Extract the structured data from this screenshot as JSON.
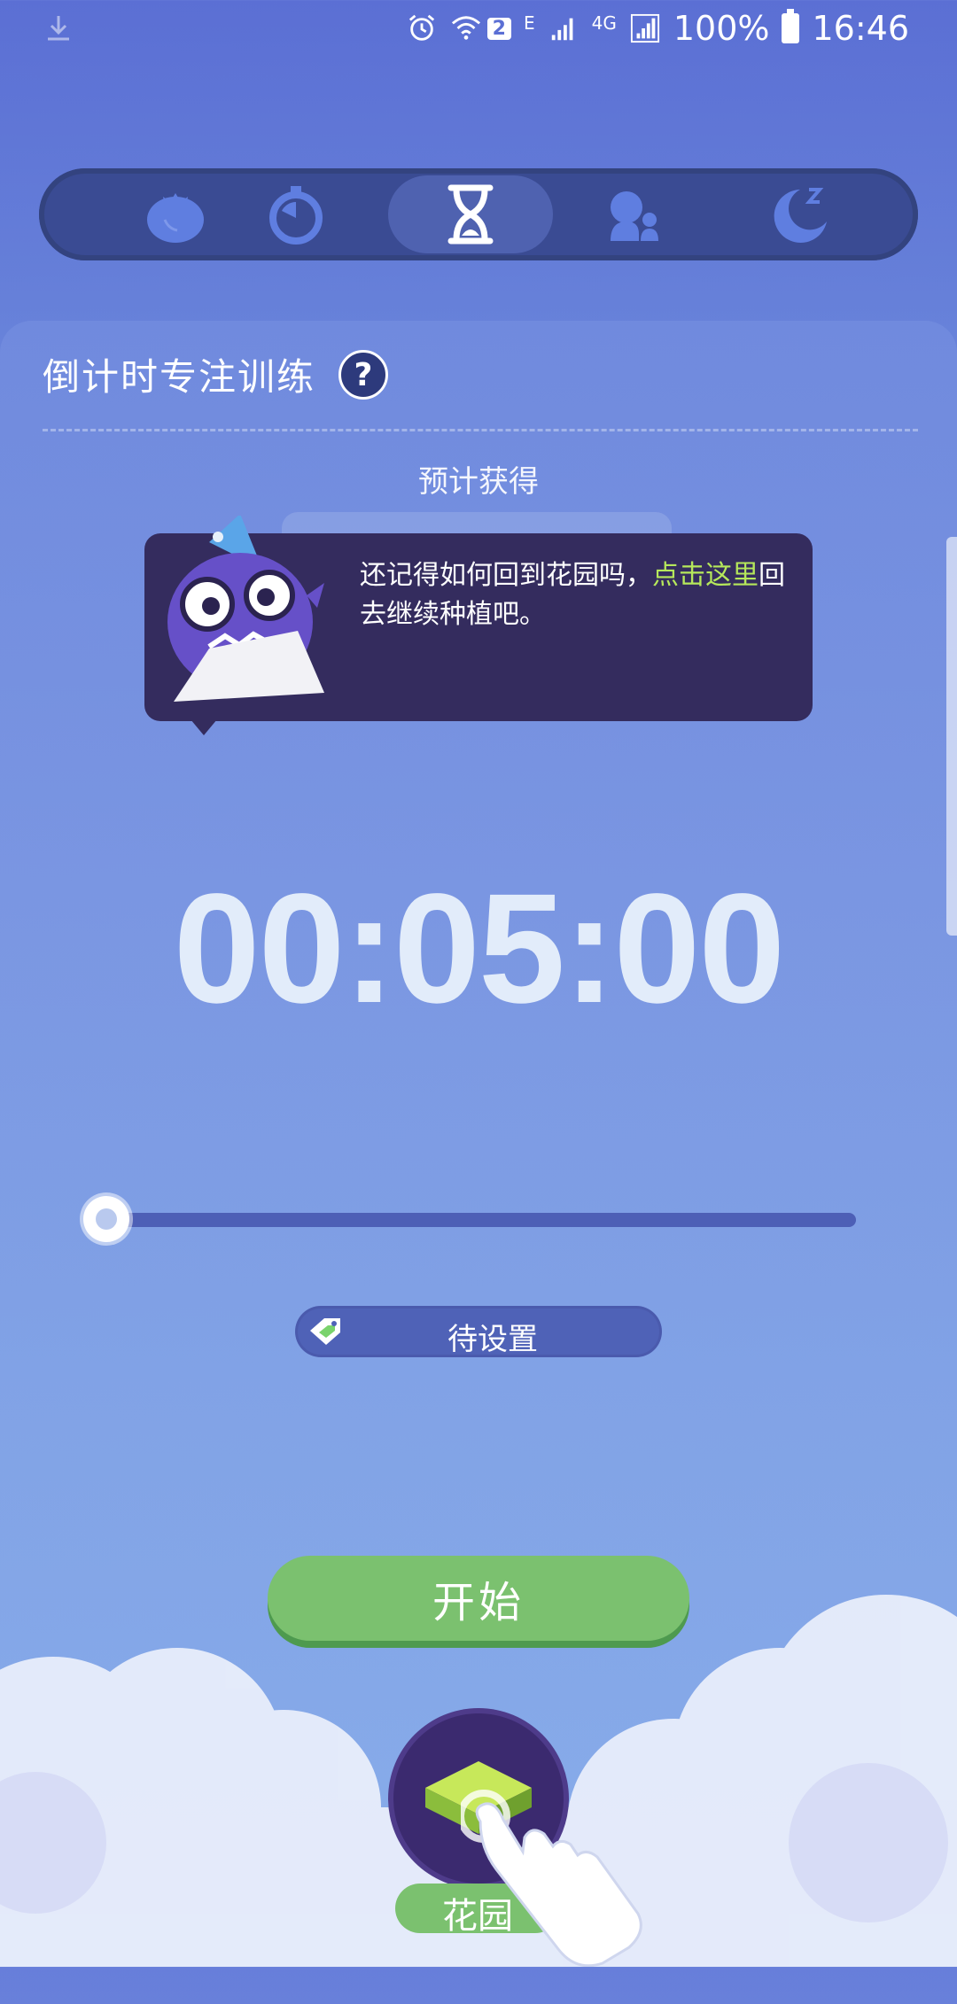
{
  "status_bar": {
    "sim_badge": "2",
    "network_type_1": "E",
    "network_type_2": "4G",
    "battery": "100%",
    "time": "16:46",
    "icons": [
      "download-icon",
      "alarm-icon",
      "wifi-icon",
      "signal-icon",
      "battery-icon"
    ]
  },
  "mode_tabs": {
    "items": [
      {
        "name": "tomato-mode",
        "icon": "tomato-icon"
      },
      {
        "name": "stopwatch-mode",
        "icon": "stopwatch-icon"
      },
      {
        "name": "countdown-mode",
        "icon": "hourglass-icon",
        "active": true
      },
      {
        "name": "meditation-mode",
        "icon": "meditation-icon"
      },
      {
        "name": "sleep-mode",
        "icon": "moon-icon"
      }
    ]
  },
  "card": {
    "title": "倒计时专注训练",
    "help_symbol": "?",
    "expected_label": "预计获得"
  },
  "tooltip": {
    "text_before": "还记得如何回到花园吗，",
    "link_text": "点击这里",
    "text_after": "回去继续种植吧。"
  },
  "timer": {
    "value": "00:05:00"
  },
  "slider": {
    "level": 0.0
  },
  "tag": {
    "label": "待设置",
    "icon": "tag-icon"
  },
  "actions": {
    "start_label": "开始",
    "garden_label": "花园"
  },
  "colors": {
    "accent_green": "#7bc16f",
    "link_green": "#b6e85b",
    "tab_bar": "#3a4b93",
    "tooltip_bg": "#342c5e"
  }
}
